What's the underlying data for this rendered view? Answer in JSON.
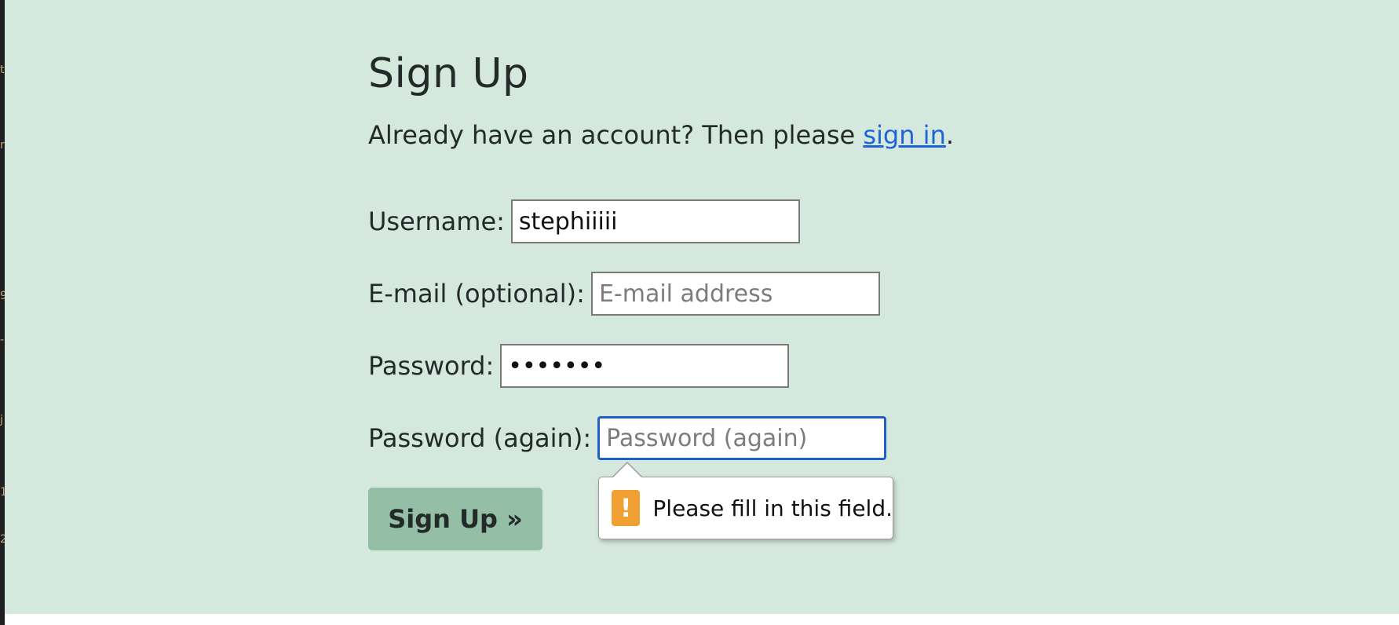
{
  "page": {
    "title": "Sign Up",
    "intro_prefix": "Already have an account? Then please ",
    "intro_link": "sign in",
    "intro_suffix": "."
  },
  "form": {
    "username": {
      "label": "Username:",
      "value": "stephiiiii",
      "placeholder": ""
    },
    "email": {
      "label": "E-mail (optional):",
      "value": "",
      "placeholder": "E-mail address"
    },
    "password": {
      "label": "Password:",
      "value": "•••••••",
      "placeholder": ""
    },
    "password_again": {
      "label": "Password (again):",
      "value": "",
      "placeholder": "Password (again)"
    },
    "submit_label": "Sign Up »"
  },
  "validation": {
    "message": "Please fill in this field.",
    "icon": "warning-icon",
    "icon_glyph": "!"
  },
  "colors": {
    "background": "#d5e8de",
    "link": "#1f63d8",
    "button": "#94bea6",
    "focus_border": "#1f5fc8",
    "warning": "#f0a033"
  }
}
